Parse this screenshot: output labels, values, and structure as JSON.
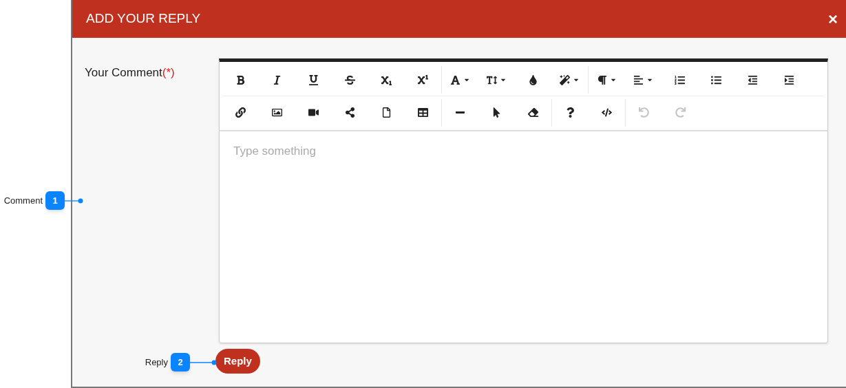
{
  "dialog": {
    "title": "ADD YOUR REPLY",
    "close_label": "×"
  },
  "field": {
    "label": "Your Comment",
    "required_mark": "(*)",
    "placeholder": "Type something"
  },
  "toolbar": {
    "rows": [
      {
        "groups": [
          {
            "items": [
              {
                "kind": "bold",
                "disabled": false
              },
              {
                "kind": "italic",
                "disabled": false
              },
              {
                "kind": "underline",
                "disabled": false
              },
              {
                "kind": "strikethrough",
                "disabled": false
              },
              {
                "kind": "subscript",
                "disabled": false
              },
              {
                "kind": "superscript",
                "disabled": false
              }
            ]
          },
          {
            "items": [
              {
                "kind": "font",
                "disabled": false,
                "dropdown": true
              },
              {
                "kind": "font-size",
                "disabled": false,
                "dropdown": true
              },
              {
                "kind": "color",
                "disabled": false
              },
              {
                "kind": "style",
                "disabled": false,
                "dropdown": true
              }
            ]
          },
          {
            "items": [
              {
                "kind": "paragraph",
                "disabled": false,
                "dropdown": true
              },
              {
                "kind": "align",
                "disabled": false,
                "dropdown": true
              },
              {
                "kind": "ordered-list",
                "disabled": false
              },
              {
                "kind": "bullet-list",
                "disabled": false
              },
              {
                "kind": "outdent",
                "disabled": false
              },
              {
                "kind": "indent",
                "disabled": false
              }
            ]
          }
        ]
      },
      {
        "groups": [
          {
            "items": [
              {
                "kind": "link",
                "disabled": false
              },
              {
                "kind": "image",
                "disabled": false
              },
              {
                "kind": "video",
                "disabled": false
              },
              {
                "kind": "share",
                "disabled": false
              },
              {
                "kind": "file",
                "disabled": false
              },
              {
                "kind": "table",
                "disabled": false
              }
            ]
          },
          {
            "items": [
              {
                "kind": "rule",
                "disabled": false
              },
              {
                "kind": "pointer",
                "disabled": false
              },
              {
                "kind": "eraser",
                "disabled": false
              }
            ]
          },
          {
            "items": [
              {
                "kind": "help",
                "disabled": false
              },
              {
                "kind": "code",
                "disabled": false
              }
            ]
          },
          {
            "items": [
              {
                "kind": "undo",
                "disabled": true
              },
              {
                "kind": "redo",
                "disabled": true
              }
            ]
          }
        ]
      }
    ]
  },
  "submit": {
    "label": "Reply"
  },
  "callouts": [
    {
      "number": "1",
      "label": "Comment"
    },
    {
      "number": "2",
      "label": "Reply"
    }
  ]
}
